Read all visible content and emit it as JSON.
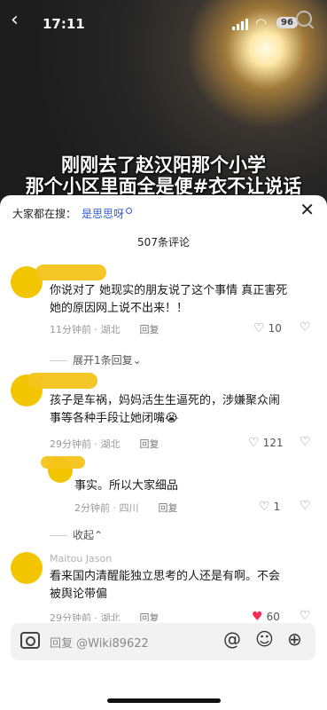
{
  "status": {
    "time": "17:11",
    "battery": "96"
  },
  "video": {
    "caption_line1": "刚刚去了赵汉阳那个小学",
    "caption_line2": "那个小区里面全是便#衣不让说话"
  },
  "sheet": {
    "trend_prefix": "大家都在搜：",
    "trend_keyword": "是思思呀",
    "comment_count": "507条评论"
  },
  "comments": [
    {
      "username": "",
      "text_line1": "你说对了 她现实的朋友说了这个事情 真正害死",
      "text_line2": "她的原因网上说不出来！！",
      "time_location": "11分钟前 · 湖北",
      "reply": "回复",
      "likes": "10",
      "expand": "展开1条回复"
    },
    {
      "username": "",
      "text_line1": "孩子是车祸，妈妈活生生逼死的，涉嫌聚众闹",
      "text_line2": "事等各种手段让她闭嘴😭",
      "time_location": "29分钟前 · 湖北",
      "reply": "回复",
      "likes": "121"
    },
    {
      "username": "",
      "text_line1": "事实。所以大家细品",
      "time_location": "2分钟前 · 四川",
      "reply": "回复",
      "likes": "1",
      "collapse": "收起"
    },
    {
      "username": "Maitou Jason",
      "text_line1": "看来国内清醒能独立思考的人还是有啊。不会",
      "text_line2": "被舆论带偏",
      "time_location": "29分钟前 · 湖北",
      "reply": "回复",
      "likes": "60"
    }
  ],
  "input": {
    "placeholder": "回复 @Wiki89622"
  },
  "colors": {
    "accent": "#fe2c55",
    "link": "#2f5bd3",
    "avatar": "#f2c500"
  }
}
